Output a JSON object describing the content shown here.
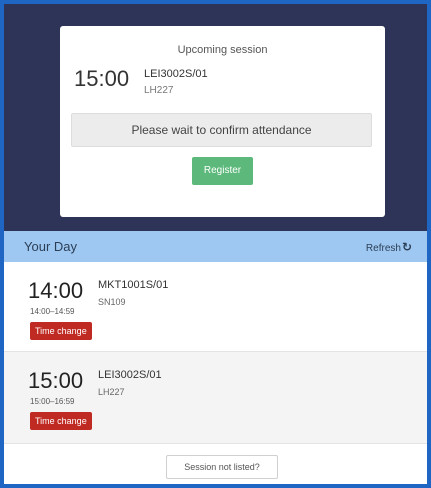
{
  "upcoming": {
    "title": "Upcoming session",
    "time": "15:00",
    "code": "LEI3002S/01",
    "room": "LH227",
    "status_message": "Please wait to confirm attendance",
    "register_label": "Register"
  },
  "day": {
    "title": "Your Day",
    "refresh_label": "Refresh",
    "refresh_icon": "↻",
    "entries": [
      {
        "time": "14:00",
        "range": "14:00–14:59",
        "code": "MKT1001S/01",
        "room": "SN109",
        "badge": "Time change"
      },
      {
        "time": "15:00",
        "range": "15:00–16:59",
        "code": "LEI3002S/01",
        "room": "LH227",
        "badge": "Time change"
      }
    ],
    "not_listed_label": "Session not listed?"
  },
  "colors": {
    "header_bg": "#2e3457",
    "day_header_bg": "#9ec8f1",
    "register_green": "#5cb97b",
    "badge_red": "#bf2a22",
    "frame_blue": "#1f66c4"
  }
}
